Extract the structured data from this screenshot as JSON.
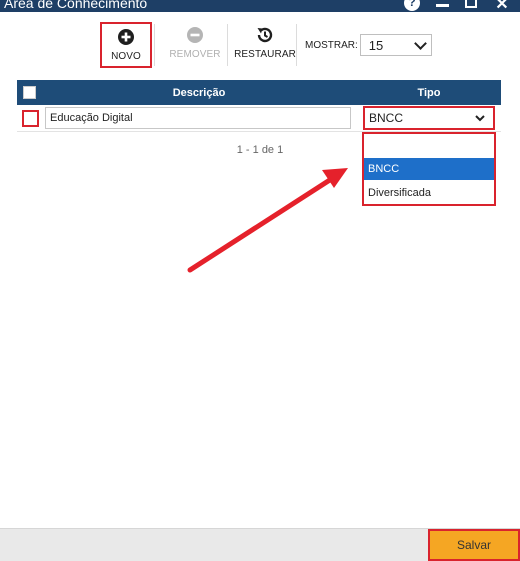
{
  "window": {
    "title": "Área de Conhecimento"
  },
  "toolbar": {
    "novo_label": "NOVO",
    "remover_label": "REMOVER",
    "restaurar_label": "RESTAURAR",
    "mostrar_label": "MOSTRAR:",
    "mostrar_value": "15"
  },
  "grid": {
    "headers": {
      "descricao": "Descrição",
      "tipo": "Tipo"
    },
    "rows": [
      {
        "descricao": "Educação Digital",
        "tipo": "BNCC"
      }
    ]
  },
  "dropdown": {
    "options": [
      "",
      "BNCC",
      "Diversificada"
    ],
    "highlighted": "BNCC"
  },
  "pager": {
    "text": "1 - 1 de 1"
  },
  "footer": {
    "save_label": "Salvar"
  },
  "colors": {
    "header_bg": "#1e4c78",
    "titlebar_bg": "#1e3f66",
    "highlight": "#d9232d",
    "save_bg": "#f5a623",
    "selected_option": "#1e6fc9"
  },
  "icons": [
    "help-icon",
    "minimize-icon",
    "maximize-icon",
    "close-icon",
    "plus-circle-icon",
    "minus-circle-icon",
    "restore-icon",
    "chevron-down-icon"
  ]
}
